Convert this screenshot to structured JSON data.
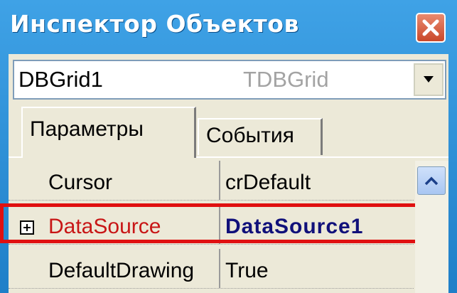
{
  "window": {
    "title": "Инспектор Объектов"
  },
  "component_selector": {
    "name": "DBGrid1",
    "type": "TDBGrid"
  },
  "tabs": [
    {
      "label": "Параметры",
      "active": true
    },
    {
      "label": "События",
      "active": false
    }
  ],
  "properties": [
    {
      "name": "Cursor",
      "value": "crDefault"
    },
    {
      "name": "DataSource",
      "value": "DataSource1",
      "expandable": true,
      "highlighted": true
    },
    {
      "name": "DefaultDrawing",
      "value": "True"
    }
  ],
  "colors": {
    "title_bar": "#2d8fd4",
    "highlight_border": "#e01010",
    "property_name_highlight": "#c81616",
    "property_value_highlight": "#10107a"
  },
  "icons": {
    "close": "close-icon",
    "dropdown": "chevron-down-icon",
    "expand": "plus-box-icon",
    "scroll_up": "chevron-up-icon"
  }
}
